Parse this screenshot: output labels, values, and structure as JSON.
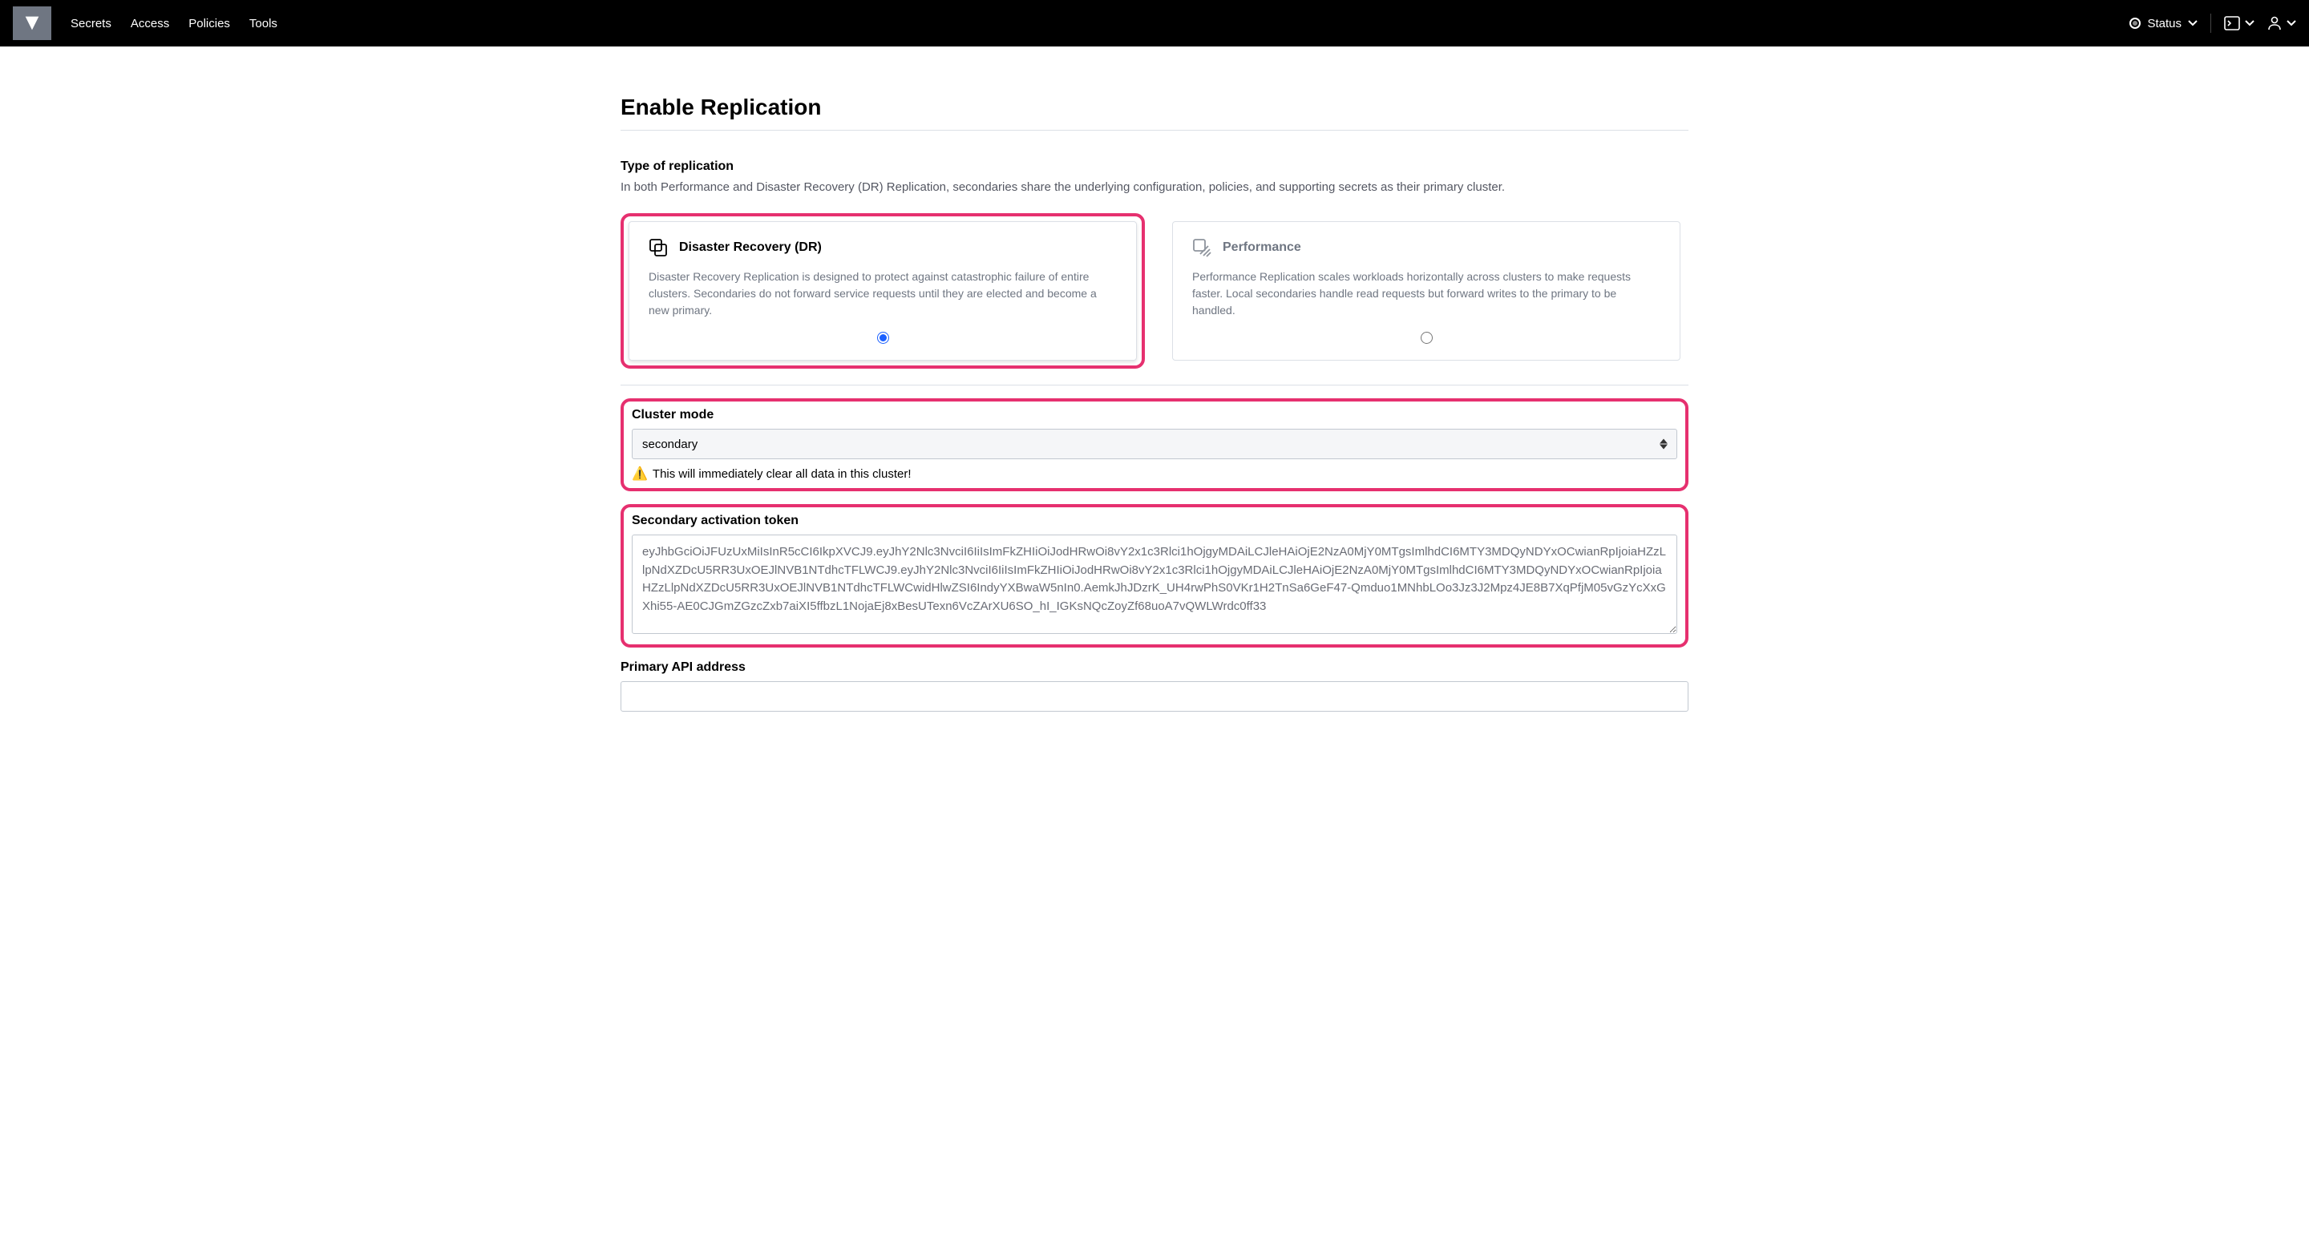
{
  "nav": {
    "links": [
      "Secrets",
      "Access",
      "Policies",
      "Tools"
    ],
    "status_label": "Status"
  },
  "page": {
    "title": "Enable Replication"
  },
  "replication_type": {
    "label": "Type of replication",
    "description": "In both Performance and Disaster Recovery (DR) Replication, secondaries share the underlying configuration, policies, and supporting secrets as their primary cluster.",
    "options": [
      {
        "title": "Disaster Recovery (DR)",
        "description": "Disaster Recovery Replication is designed to protect against catastrophic failure of entire clusters. Secondaries do not forward service requests until they are elected and become a new primary.",
        "selected": true
      },
      {
        "title": "Performance",
        "description": "Performance Replication scales workloads horizontally across clusters to make requests faster. Local secondaries handle read requests but forward writes to the primary to be handled.",
        "selected": false
      }
    ]
  },
  "cluster_mode": {
    "label": "Cluster mode",
    "value": "secondary",
    "warning": "This will immediately clear all data in this cluster!"
  },
  "activation_token": {
    "label": "Secondary activation token",
    "value": "eyJhbGciOiJFUzUxMiIsInR5cCI6IkpXVCJ9.eyJhY2Nlc3NvciI6IiIsImFkZHIiOiJodHRwOi8vY2x1c3Rlci1hOjgyMDAiLCJleHAiOjE2NzA0MjY0MTgsImlhdCI6MTY3MDQyNDYxOCwianRpIjoiaHZzLlpNdXZDcU5RR3UxOEJlNVB1NTdhcTFLWCJ9.eyJhY2Nlc3NvciI6IiIsImFkZHIiOiJodHRwOi8vY2x1c3Rlci1hOjgyMDAiLCJleHAiOjE2NzA0MjY0MTgsImlhdCI6MTY3MDQyNDYxOCwianRpIjoiaHZzLlpNdXZDcU5RR3UxOEJlNVB1NTdhcTFLWCwidHlwZSI6IndyYXBwaW5nIn0.AemkJhJDzrK_UH4rwPhS0VKr1H2TnSa6GeF47-Qmduo1MNhbLOo3Jz3J2Mpz4JE8B7XqPfjM05vGzYcXxGXhi55-AE0CJGmZGzcZxb7aiXI5ffbzL1NojaEj8xBesUTexn6VcZArXU6SO_hI_IGKsNQcZoyZf68uoA7vQWLWrdc0ff33"
  },
  "primary_api": {
    "label": "Primary API address",
    "value": ""
  }
}
